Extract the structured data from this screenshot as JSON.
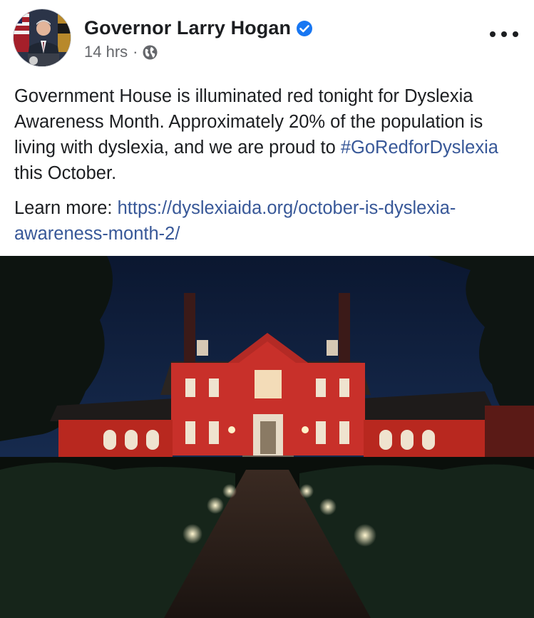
{
  "author": {
    "name": "Governor Larry Hogan",
    "verified": true,
    "avatar": "avatar-photo"
  },
  "meta": {
    "time": "14 hrs",
    "separator": "·",
    "privacy_icon": "globe-icon"
  },
  "menu": {
    "icon": "more-options-icon"
  },
  "post": {
    "text_main": "Government House is illuminated red tonight for Dyslexia Awareness Month. Approximately 20% of the population is living with dyslexia, and we are proud to",
    "hashtag": "#GoRedforDyslexia",
    "text_after_hashtag": " this October.",
    "learn_more_label": "Learn more:",
    "learn_more_url": "https://dyslexiaida.org/october-is-dyslexia-awareness-month-2/"
  },
  "photo": {
    "subject": "red-lit-house-night-photo"
  },
  "colors": {
    "link": "#385898",
    "verified_badge": "#1877f2",
    "meta_gray": "#65676b",
    "house_red": "#c8302a"
  }
}
